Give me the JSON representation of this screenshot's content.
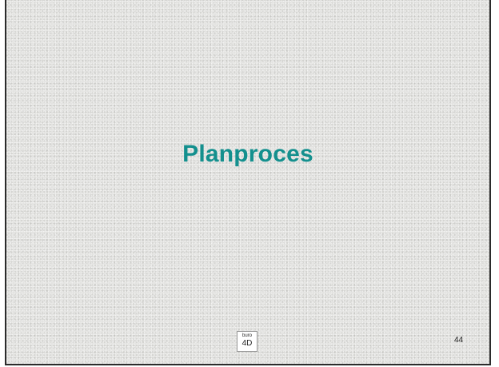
{
  "slide": {
    "title": "Planproces",
    "page_number": "44",
    "logo": {
      "line1": "buro",
      "line2": "4D"
    }
  },
  "colors": {
    "title": "#14908e",
    "background": "#e3e3e1",
    "frame_border": "#2b2b2b"
  }
}
